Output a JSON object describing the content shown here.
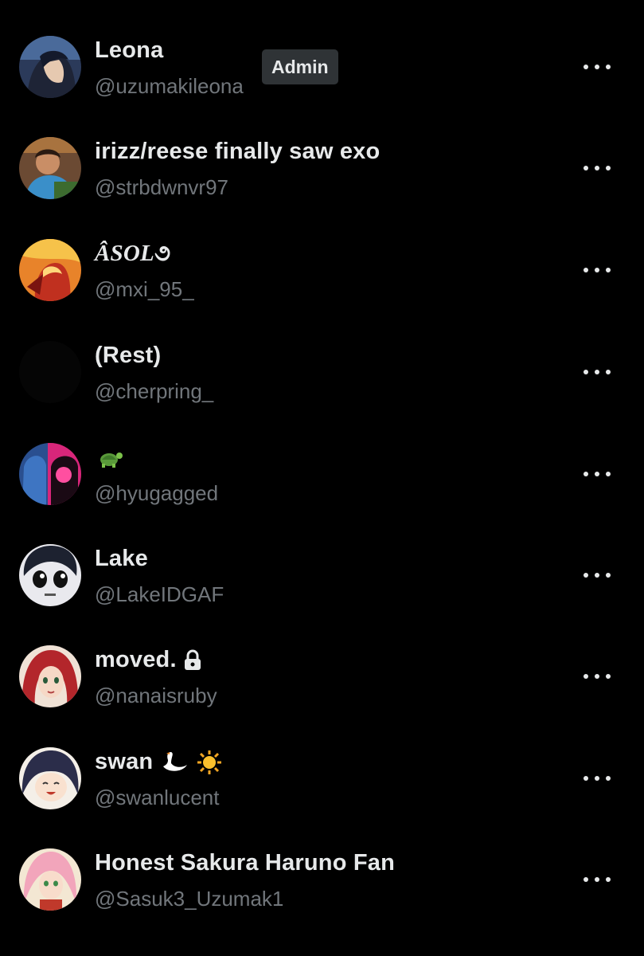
{
  "members": [
    {
      "name": "Leona",
      "handle": "@uzumakileona",
      "badge": "Admin"
    },
    {
      "name": "irizz/reese finally saw exo",
      "handle": "@strbdwnvr97"
    },
    {
      "name": "ÂSOL",
      "name_suffix": "૭",
      "handle": "@mxi_95_"
    },
    {
      "name": "(Rest)",
      "handle": "@cherpring_"
    },
    {
      "name": "",
      "name_emoji": "turtle",
      "handle": "@hyugagged"
    },
    {
      "name": "Lake",
      "handle": "@LakeIDGAF"
    },
    {
      "name": "moved.",
      "name_icon": "lock-icon",
      "handle": "@nanaisruby"
    },
    {
      "name": "swan",
      "name_emoji": "swan sun",
      "handle": "@swanlucent"
    },
    {
      "name": "Honest Sakura Haruno Fan",
      "handle": "@Sasuk3_Uzumak1"
    }
  ],
  "colors": {
    "background": "#000000",
    "name_text": "#e7e9ea",
    "handle_text": "#71767b",
    "badge_bg": "#2f3336"
  }
}
